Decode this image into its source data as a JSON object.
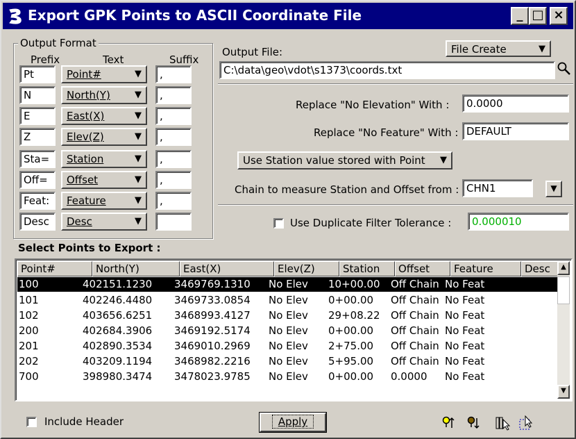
{
  "window": {
    "title": "Export GPK Points to ASCII Coordinate File",
    "controls": {
      "minimize": "_",
      "maximize": "□",
      "close": "×"
    },
    "accent": "#000080"
  },
  "output_format": {
    "group_label": "Output Format",
    "col_prefix": "Prefix",
    "col_text": "Text",
    "col_suffix": "Suffix",
    "rows": [
      {
        "prefix": "Pt",
        "text": "Point#",
        "suffix": ","
      },
      {
        "prefix": "N",
        "text": "North(Y)",
        "suffix": ","
      },
      {
        "prefix": "E",
        "text": "East(X)",
        "suffix": ","
      },
      {
        "prefix": "Z",
        "text": "Elev(Z)",
        "suffix": ","
      },
      {
        "prefix": "Sta=",
        "text": "Station",
        "suffix": ","
      },
      {
        "prefix": "Off=",
        "text": "Offset",
        "suffix": ","
      },
      {
        "prefix": "Feat:",
        "text": "Feature",
        "suffix": ","
      },
      {
        "prefix": "Desc",
        "text": "Desc",
        "suffix": ""
      }
    ]
  },
  "output_file": {
    "label": "Output File:",
    "mode": "File Create",
    "path": "C:\\data\\geo\\vdot\\s1373\\coords.txt",
    "browse_icon": "magnifier-icon"
  },
  "options": {
    "no_elev_label": "Replace \"No Elevation\" With :",
    "no_elev_value": "0.0000",
    "no_feat_label": "Replace \"No Feature\" With :",
    "no_feat_value": "DEFAULT",
    "station_mode": "Use Station value stored with Point",
    "chain_label": "Chain to measure Station and Offset from :",
    "chain_value": "CHN1",
    "dup_label": "Use Duplicate Filter Tolerance :",
    "dup_value": "0.000010",
    "dup_color": "#00b000",
    "dup_checked": false
  },
  "points": {
    "label": "Select Points to Export :",
    "columns": [
      "Point#",
      "North(Y)",
      "East(X)",
      "Elev(Z)",
      "Station",
      "Offset",
      "Feature",
      "Desc"
    ],
    "rows": [
      {
        "point": "100",
        "north": "402151.1230",
        "east": "3469769.1310",
        "elev": "No Elev",
        "station": "10+00.00",
        "offset": "Off Chain",
        "feature": "No Feat",
        "desc": "",
        "selected": true
      },
      {
        "point": "101",
        "north": "402246.4480",
        "east": "3469733.0854",
        "elev": "No Elev",
        "station": "0+00.00",
        "offset": "Off Chain",
        "feature": "No Feat",
        "desc": "",
        "selected": false
      },
      {
        "point": "102",
        "north": "403656.6251",
        "east": "3468993.4127",
        "elev": "No Elev",
        "station": "29+08.22",
        "offset": "Off Chain",
        "feature": "No Feat",
        "desc": "",
        "selected": false
      },
      {
        "point": "200",
        "north": "402684.3906",
        "east": "3469192.5174",
        "elev": "No Elev",
        "station": "0+00.00",
        "offset": "Off Chain",
        "feature": "No Feat",
        "desc": "",
        "selected": false
      },
      {
        "point": "201",
        "north": "402890.3534",
        "east": "3469010.2969",
        "elev": "No Elev",
        "station": "2+75.00",
        "offset": "Off Chain",
        "feature": "No Feat",
        "desc": "",
        "selected": false
      },
      {
        "point": "202",
        "north": "403209.1194",
        "east": "3468982.2216",
        "elev": "No Elev",
        "station": "5+95.00",
        "offset": "Off Chain",
        "feature": "No Feat",
        "desc": "",
        "selected": false
      },
      {
        "point": "700",
        "north": "398980.3474",
        "east": "3478023.9785",
        "elev": "No Elev",
        "station": "0+00.00",
        "offset": "0.0000",
        "feature": "No Feat",
        "desc": "",
        "selected": false
      }
    ]
  },
  "footer": {
    "include_header_label": "Include Header",
    "include_header_checked": false,
    "apply_label": "Apply",
    "tools": [
      "select-point-icon",
      "deselect-point-icon",
      "select-all-icon",
      "select-by-window-icon"
    ]
  }
}
